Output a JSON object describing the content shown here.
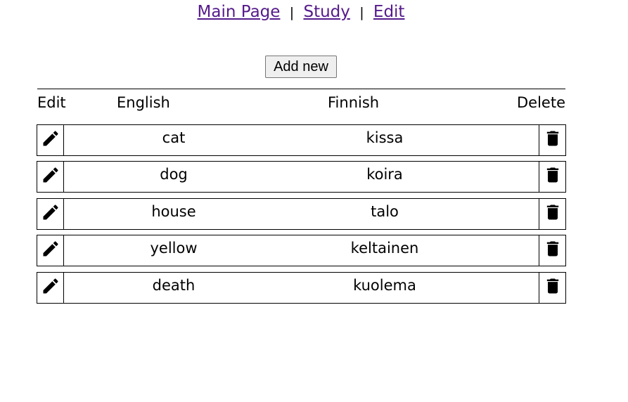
{
  "nav": {
    "links": [
      {
        "label": "Main Page"
      },
      {
        "label": "Study"
      },
      {
        "label": "Edit"
      }
    ],
    "separator": "|"
  },
  "toolbar": {
    "add_label": "Add new"
  },
  "table": {
    "headers": {
      "edit": "Edit",
      "english": "English",
      "finnish": "Finnish",
      "delete": "Delete"
    },
    "rows": [
      {
        "english": "cat",
        "finnish": "kissa"
      },
      {
        "english": "dog",
        "finnish": "koira"
      },
      {
        "english": "house",
        "finnish": "talo"
      },
      {
        "english": "yellow",
        "finnish": "keltainen"
      },
      {
        "english": "death",
        "finnish": "kuolema"
      }
    ]
  },
  "icons": {
    "edit": "pencil-icon",
    "delete": "trash-icon"
  },
  "colors": {
    "link": "#551a8b",
    "button_bg": "#efefef"
  }
}
